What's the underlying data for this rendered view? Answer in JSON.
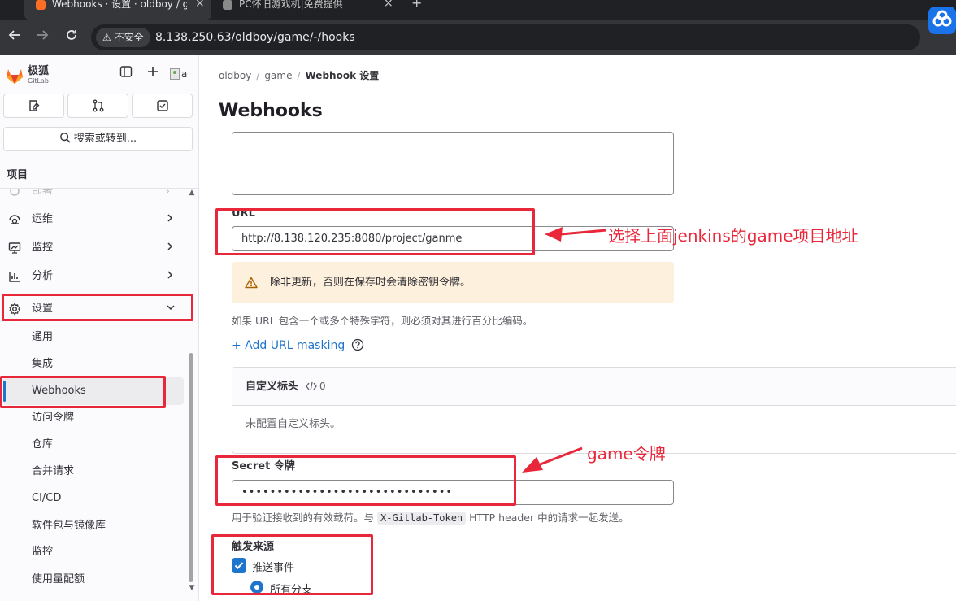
{
  "browser": {
    "tabs": [
      {
        "title": "Webhooks · 设置 · oldboy / g",
        "active": true
      },
      {
        "title": "PC怀旧游戏机|免费提供",
        "active": false
      }
    ],
    "security_label": "不安全",
    "url": "8.138.250.63/oldboy/game/-/hooks",
    "icons": [
      "back-arrow-icon",
      "forward-arrow-icon",
      "reload-icon",
      "warning-icon",
      "baidu-netdisk-icon"
    ]
  },
  "sidebar": {
    "brand_name": "极狐",
    "brand_sub": "GitLab",
    "avatar_alt": "a",
    "search_label": "搜索或转到...",
    "section_title": "项目",
    "partial_item": "部署",
    "items": [
      {
        "label": "运维",
        "icon": "monitor-ops-icon",
        "expandable": true
      },
      {
        "label": "监控",
        "icon": "monitor-icon",
        "expandable": true
      },
      {
        "label": "分析",
        "icon": "chart-icon",
        "expandable": true
      },
      {
        "label": "设置",
        "icon": "gear-icon",
        "expanded": true
      }
    ],
    "sub_items": [
      "通用",
      "集成",
      "Webhooks",
      "访问令牌",
      "仓库",
      "合并请求",
      "CI/CD",
      "软件包与镜像库",
      "监控",
      "使用量配额"
    ],
    "active_sub_item": "Webhooks"
  },
  "breadcrumb": [
    "oldboy",
    "game",
    "Webhook 设置"
  ],
  "page_title": "Webhooks",
  "form": {
    "url_label": "URL",
    "url_value": "http://8.138.120.235:8080/project/ganme",
    "alert_text": "除非更新，否则在保存时会清除密钥令牌。",
    "url_helper": "如果 URL 包含一个或多个特殊字符，则必须对其进行百分比编码。",
    "add_masking": "+ Add URL masking",
    "custom_headers_title": "自定义标头",
    "custom_headers_count": "0",
    "custom_headers_empty": "未配置自定义标头。",
    "secret_label": "Secret 令牌",
    "secret_value": "••••••••••••••••••••••••••••••",
    "secret_helper_before": "用于验证接收到的有效载荷。与",
    "secret_helper_code": "X-Gitlab-Token",
    "secret_helper_after": "HTTP header 中的请求一起发送。",
    "trigger_label": "触发来源",
    "push_events_label": "推送事件",
    "push_events_checked": true,
    "all_branches_label": "所有分支",
    "all_branches_selected": true
  },
  "annotations": {
    "url_note": "选择上面jenkins的game项目地址",
    "secret_note": "game令牌",
    "color": "#e8283a"
  },
  "colors": {
    "accent": "#1f75cb",
    "alert_bg": "#fdf1dd",
    "annotation_red": "#e8283a",
    "gitlab_orange": "#fc6d26"
  }
}
